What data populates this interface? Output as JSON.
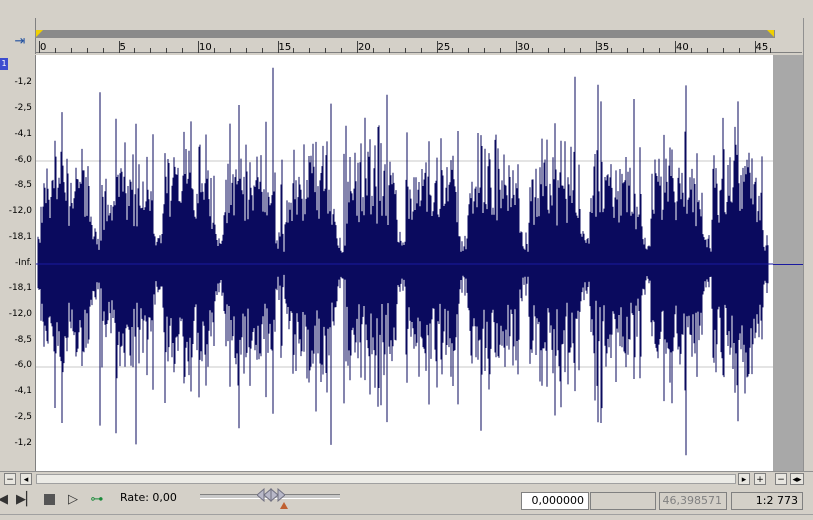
{
  "ruler": {
    "ticks": [
      "0",
      "5",
      "10",
      "15",
      "20",
      "25",
      "30",
      "35",
      "40",
      "45"
    ]
  },
  "gutter": {
    "channel_label": "1",
    "db_labels": [
      "-1,2",
      "-2,5",
      "-4,1",
      "-6,0",
      "-8,5",
      "-12,0",
      "-18,1",
      "-Inf.",
      "-18,1",
      "-12,0",
      "-8,5",
      "-6,0",
      "-4,1",
      "-2,5",
      "-1,2"
    ]
  },
  "scrollbar": {
    "left_minus": "−",
    "left_arrow": "◂",
    "right_arrow": "▸",
    "plus": "+",
    "minus": "−",
    "expand": "◂▸"
  },
  "transport": {
    "rate_label": "Rate: 0,00"
  },
  "status": {
    "selection_start": "0,000000",
    "selection_end": "",
    "length": "46,398571",
    "zoom": "1:2 773"
  },
  "colors": {
    "waveform": "#0a0a5e",
    "background": "#ffffff"
  }
}
